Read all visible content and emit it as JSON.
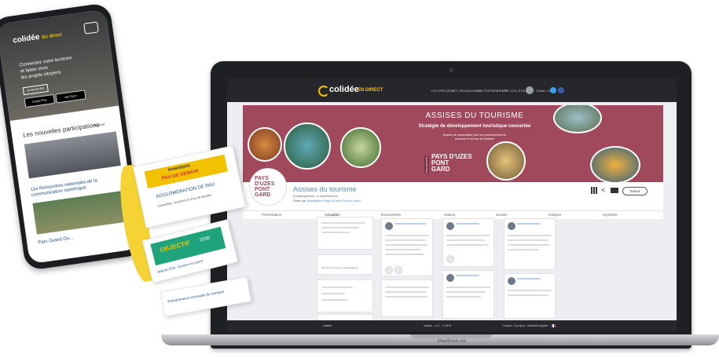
{
  "laptop": {
    "brand_logo": "colidée",
    "brand_sub": "EN DIRECT",
    "nav": [
      "LES PROJETS",
      "LES ORGANISMES",
      "LES ÉVÉNEMENTS",
      "LES COLLÈGES"
    ],
    "user_name": "Tobias Co.",
    "banner": {
      "title": "ASSISES DU TOURISME",
      "subtitle": "Stratégie de développement touristique concertée",
      "description_1": "Espace de concertation pour les professionnels du",
      "description_2": "tourisme et les élus du territoire",
      "brand_1": "PAYS D'UZES",
      "brand_2": "PONT",
      "brand_3": "GARD",
      "brand_tag": "DESTINATION"
    },
    "profile": {
      "avatar_1": "PAYS",
      "avatar_2": "D'UZES",
      "avatar_3": "PONT",
      "avatar_4": "GARD",
      "title": "Assises du tourisme",
      "meta": "8 participations • 8 contributeurs",
      "by_prefix": "Porté par",
      "by_org": "Destination Pays d'Uzès Pont du Gard",
      "follow_label": "Suivre"
    },
    "tabs": [
      "Présentation",
      "Actualités",
      "Événements",
      "Galerie",
      "Sonder",
      "Analyser",
      "Synthèse"
    ],
    "sidebar": {
      "title": "Rechercher dans les participations"
    },
    "footer": {
      "logo": "colidée",
      "center": "colidée - v1.1 - © 2019",
      "right": "Contact - À propos - Mentions légales"
    },
    "model": "MacBook Air"
  },
  "phone": {
    "logo": "colidée",
    "logo_sub": "En direct",
    "hero_1": "Connectez votre territoire",
    "hero_2": "et faites vivre",
    "hero_3": "les projets citoyens",
    "hero_button": "JE M'INSCRIS",
    "store_1": "Google Play",
    "store_2": "App Store",
    "section_title": "Les nouvelles participations",
    "section_link": "Voir tout",
    "card_title": "11e Rencontres nationales de la communication numérique",
    "card2_title": "Parc Grand Ou..."
  },
  "paper": {
    "headline_1": "inventons",
    "headline_2": "PAU DE DEMAIN",
    "line_1": "AGGLOMÉRATION DE PAU",
    "line_2": "Ensemble, inventons le Pau de demain",
    "objectif": "OBJECTIF",
    "year": "2030",
    "line_3": "Objectif 2030 : Dessine ton avenir",
    "line_4": "Entrepreneurs innovants du territoire"
  }
}
